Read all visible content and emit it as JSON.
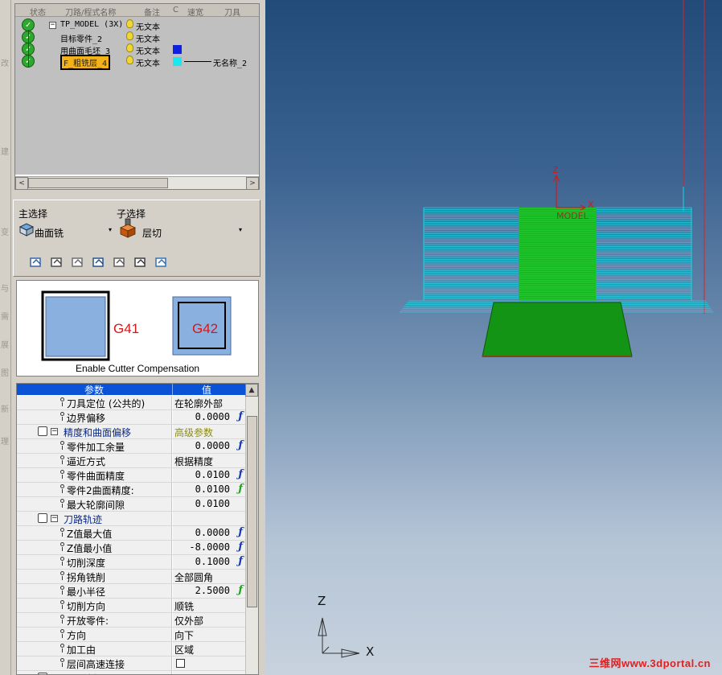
{
  "edge_strip": {
    "chars": [
      "改",
      "建",
      "变",
      "与",
      "需",
      "展",
      "图",
      "新",
      "理"
    ]
  },
  "tree": {
    "headers": [
      "状态",
      "刀路/程式名称",
      "备注",
      "C",
      "速宽",
      "刀具"
    ],
    "rows": [
      {
        "name": "TP_MODEL (3X)",
        "note": "无文本",
        "expand": "−",
        "tool": ""
      },
      {
        "name": "目标零件_2",
        "note": "无文本",
        "tool": ""
      },
      {
        "name": "用曲面毛坯_3",
        "note": "无文本",
        "swatch": "#1020e0",
        "tool": ""
      },
      {
        "name": "F_粗铣层_4",
        "note": "无文本",
        "swatch": "#18e8f0",
        "tool": "无名称_2",
        "selected": true
      }
    ],
    "left_arrow": "<",
    "right_arrow": ">"
  },
  "selection": {
    "main_label": "主选择",
    "main_value": "曲面铣",
    "sub_label": "子选择",
    "sub_value": "层切",
    "dropdown_arrow": "▾",
    "icons": [
      "toolpath-icon",
      "machine-icon",
      "tool-icon",
      "holder-icon",
      "verify-icon",
      "settings-icon",
      "export-icon"
    ]
  },
  "preview": {
    "left_tag": "G41",
    "right_tag": "G42",
    "caption": "Enable Cutter Compensation"
  },
  "grid": {
    "col_param": "参数",
    "col_value": "值",
    "rows": [
      {
        "type": "param",
        "label": "刀具定位 (公共的)",
        "value": "在轮廓外部"
      },
      {
        "type": "param",
        "label": "边界偏移",
        "num": "0.0000",
        "fx": "ƒ"
      },
      {
        "type": "group",
        "label": "精度和曲面偏移",
        "value": "高级参数",
        "box": "−"
      },
      {
        "type": "param",
        "label": "零件加工余量",
        "num": "0.0000",
        "fx": "ƒ"
      },
      {
        "type": "param",
        "label": "逼近方式",
        "value": "根据精度"
      },
      {
        "type": "param",
        "label": "零件曲面精度",
        "num": "0.0100",
        "fx": "ƒ"
      },
      {
        "type": "param",
        "label": "零件2曲面精度:",
        "num": "0.0100",
        "fx": "ƒ",
        "fx_green": true
      },
      {
        "type": "param",
        "label": "最大轮廓间隙",
        "num": "0.0100"
      },
      {
        "type": "group",
        "label": "刀路轨迹",
        "value": "",
        "box": "−"
      },
      {
        "type": "param",
        "label": "Z值最大值",
        "num": "0.0000",
        "fx": "ƒ"
      },
      {
        "type": "param",
        "label": "Z值最小值",
        "num": "-8.0000",
        "fx": "ƒ"
      },
      {
        "type": "param",
        "label": "切削深度",
        "num": "0.1000",
        "fx": "ƒ"
      },
      {
        "type": "param",
        "label": "拐角铣削",
        "value": "全部圆角"
      },
      {
        "type": "param",
        "label": "最小半径",
        "num": "2.5000",
        "fx": "ƒ",
        "fx_green": true
      },
      {
        "type": "param",
        "label": "切削方向",
        "value": "顺铣"
      },
      {
        "type": "param",
        "label": "开放零件:",
        "value": "仅外部"
      },
      {
        "type": "param",
        "label": "方向",
        "value": "向下"
      },
      {
        "type": "param",
        "label": "加工由",
        "value": "区域"
      },
      {
        "type": "param",
        "label": "层间高速连接",
        "checkbox": true
      },
      {
        "type": "group",
        "label": "层间铣削",
        "value": "",
        "box": "−"
      }
    ]
  },
  "viewport": {
    "model_label": "MODEL",
    "axis_x_small": "X",
    "axis_z_small": "Z",
    "axis_x": "X",
    "axis_z": "Z",
    "watermark": "三维网www.3dportal.cn",
    "colors": {
      "toolpath": "#17d6e6",
      "part": "#19c21e",
      "base": "#0f8f12",
      "stock_line": "#e02020"
    }
  }
}
